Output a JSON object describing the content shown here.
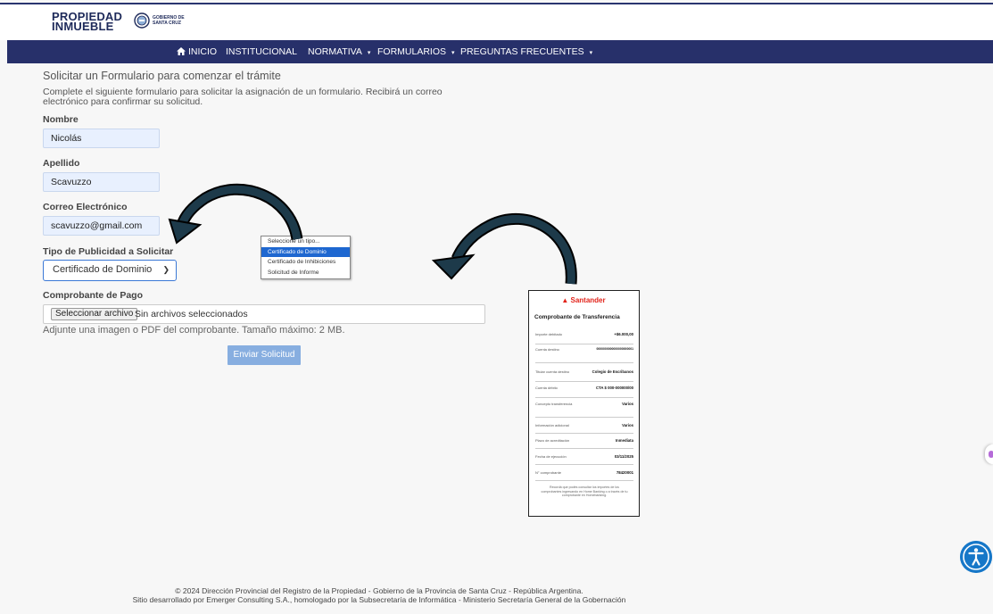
{
  "header": {
    "logo_line1": "PROPIEDAD",
    "logo_line2": "INMUEBLE",
    "gov_line1": "GOBIERNO DE",
    "gov_line2": "SANTA CRUZ"
  },
  "nav": {
    "items": [
      {
        "label": "INICIO",
        "icon": "home-icon"
      },
      {
        "label": "INSTITUCIONAL"
      },
      {
        "label": "NORMATIVA",
        "has_caret": true
      },
      {
        "label": "FORMULARIOS",
        "has_caret": true
      },
      {
        "label": "PREGUNTAS FRECUENTES",
        "has_caret": true
      }
    ],
    "caret": "▾"
  },
  "form": {
    "title": "Solicitar un Formulario para comenzar el trámite",
    "intro": "Complete el siguiente formulario para solicitar la asignación de un formulario. Recibirá un correo electrónico para confirmar su solicitud.",
    "nombre_label": "Nombre",
    "nombre_value": "Nicolás",
    "apellido_label": "Apellido",
    "apellido_value": "Scavuzzo",
    "correo_label": "Correo Electrónico",
    "correo_value": "scavuzzo@gmail.com",
    "tipo_label": "Tipo de Publicidad a Solicitar",
    "tipo_value": "Certificado de Dominio",
    "tipo_options": [
      "Seleccione un tipo...",
      "Certificado de Dominio",
      "Certificado de Inhibiciones",
      "Solicitud de Informe"
    ],
    "tipo_selected_index": 1,
    "comprobante_label": "Comprobante de Pago",
    "file_button": "Seleccionar archivo",
    "file_status": "Sin archivos seleccionados",
    "file_help": "Adjunte una imagen o PDF del comprobante. Tamaño máximo: 2 MB.",
    "submit_label": "Enviar Solicitud"
  },
  "receipt": {
    "bank": "Santander",
    "title": "Comprobante de Transferencia",
    "rows": [
      {
        "label": "Importe debitado",
        "value": "+$6.000,00"
      },
      {
        "label": "Cuenta destino",
        "value": "0000000000000000000001"
      },
      {
        "label": "Titular cuenta destino",
        "value": "Colegio de Escribanos"
      },
      {
        "label": "Cuenta débito",
        "value": "CTA $   000-000000/00"
      },
      {
        "label": "Concepto transferencia",
        "value": "Varios"
      },
      {
        "label": "Información adicional",
        "value": "Varios"
      },
      {
        "label": "Plazo de acreditación",
        "value": "Inmediata"
      },
      {
        "label": "Fecha de ejecución",
        "value": "03/11/2025"
      },
      {
        "label": "N° comprobante",
        "value": "78420001"
      }
    ],
    "footnote": "Recordá que podés consultar los importes de los comprobantes ingresando en Home Banking o a través de tu comprobante en Homebanking."
  },
  "footer": {
    "line1": "© 2024 Dirección Provincial del Registro de la Propiedad - Gobierno de la Provincia de Santa Cruz - República Argentina.",
    "line2": "Sitio desarrollado por Emerger Consulting S.A., homologado por la Subsecretaría de Informática - Ministerio Secretaría General de la Gobernación"
  },
  "colors": {
    "navbar": "#27306a",
    "input_bg": "#e8f0fe",
    "submit": "#87aee0",
    "selected_option": "#1e67d0",
    "arrow": "#1d3a4a",
    "brand_red": "#e2231a",
    "accessibility": "#1677c8"
  },
  "icons": {
    "accessibility": "accessibility-icon",
    "seal": "government-seal-icon",
    "select_chevron": "chevron-down-icon"
  }
}
